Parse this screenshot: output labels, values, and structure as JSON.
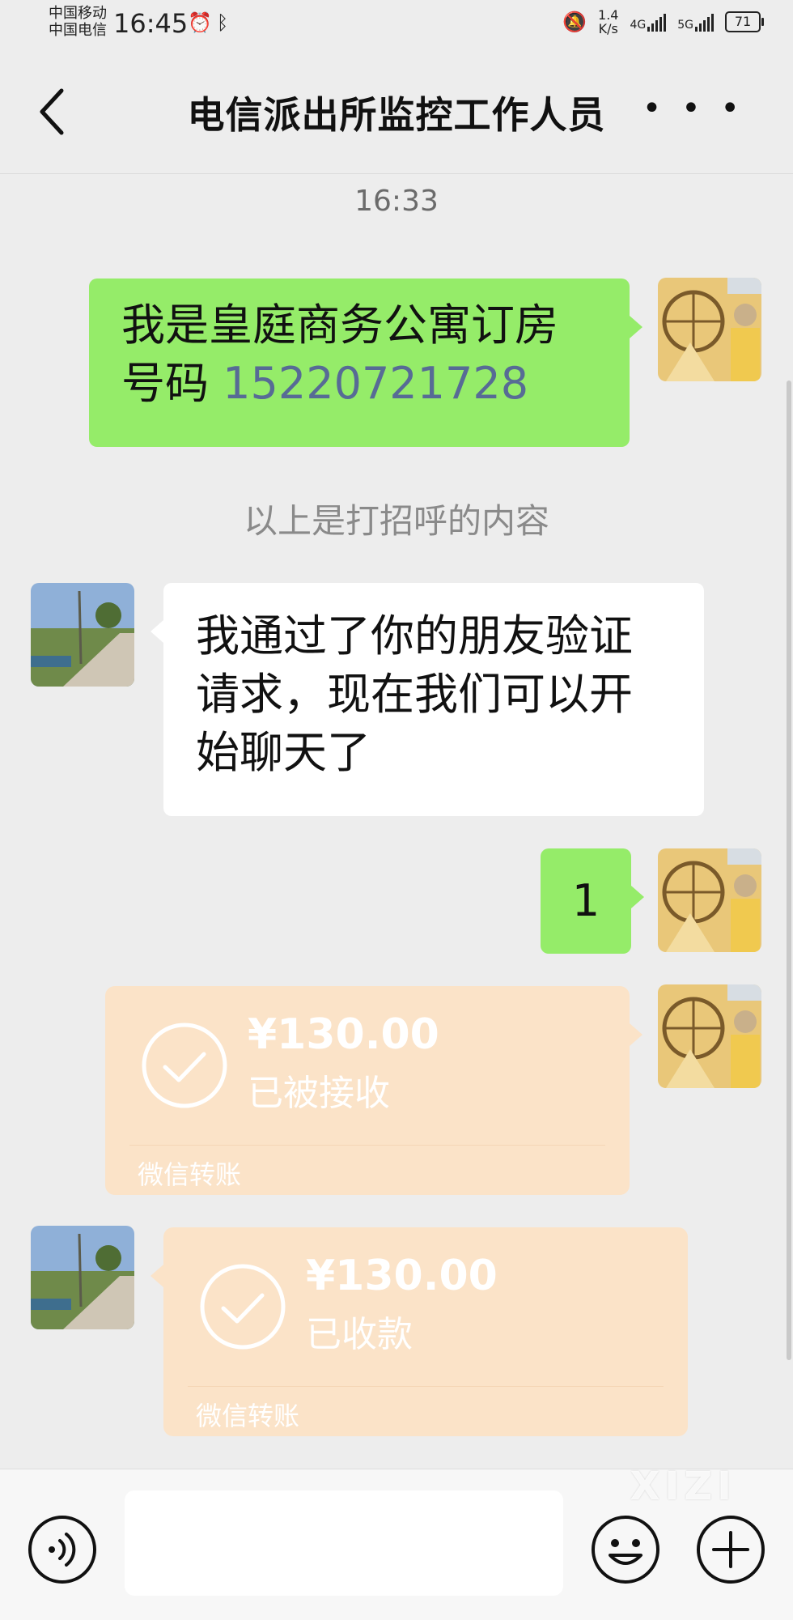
{
  "status_bar": {
    "carrier_1": "中国移动",
    "carrier_2": "中国电信",
    "time": "16:45",
    "speed_value": "1.4",
    "speed_unit": "K/s",
    "network_1": "4G",
    "network_2": "5G",
    "battery": "71"
  },
  "header": {
    "title": "电信派出所监控工作人员"
  },
  "chat": {
    "timestamp": "16:33",
    "messages": [
      {
        "side": "right",
        "text_main": "我是皇庭商务公寓订房号码 ",
        "phone": "15220721728"
      },
      {
        "side": "left",
        "text": "我通过了你的朋友验证请求，现在我们可以开始聊天了"
      },
      {
        "side": "right",
        "text": "1"
      }
    ],
    "system_message": "以上是打招呼的内容",
    "transfers": [
      {
        "side": "right",
        "amount": "¥130.00",
        "status": "已被接收",
        "label": "微信转账"
      },
      {
        "side": "left",
        "amount": "¥130.00",
        "status": "已收款",
        "label": "微信转账"
      }
    ]
  },
  "input_bar": {
    "placeholder": ""
  },
  "watermark": "XIZI",
  "icons": {
    "back": "back-arrow-icon",
    "more": "more-icon",
    "voice": "voice-icon",
    "emoji": "emoji-icon",
    "plus": "plus-icon"
  }
}
